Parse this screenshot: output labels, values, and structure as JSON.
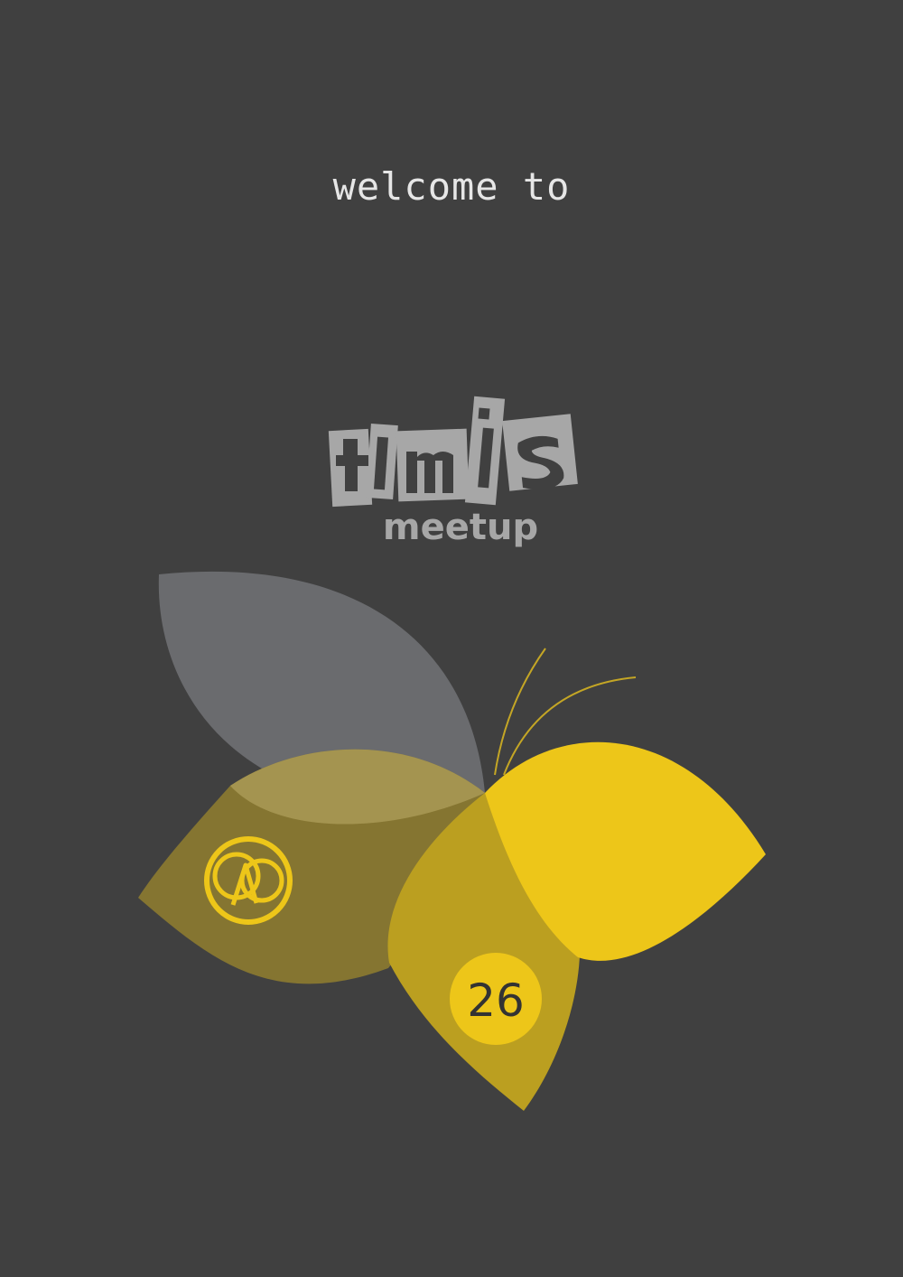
{
  "welcome_text": "welcome to",
  "logo": {
    "wordmark": "tim.js",
    "subtitle": "meetup"
  },
  "edition_number": "26",
  "colors": {
    "background": "#404040",
    "wing_gray": "#6a6b6e",
    "wing_olive": "#857531",
    "wing_gold": "#bb9f20",
    "wing_yellow": "#edc619",
    "logo_gray": "#a7a7a7"
  },
  "icons": [
    "butterfly-illustration",
    "lambda-at-icon"
  ]
}
